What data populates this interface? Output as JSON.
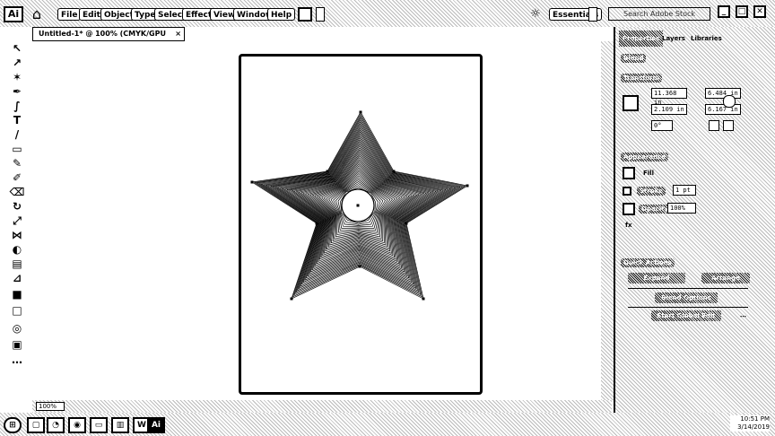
{
  "app": {
    "logo": "Ai"
  },
  "menubar": {
    "items": [
      "File",
      "Edit",
      "Object",
      "Type",
      "Select",
      "Effect",
      "View",
      "Window",
      "Help"
    ],
    "workspace": "Essentials",
    "search_placeholder": "Search Adobe Stock"
  },
  "document": {
    "tab_title": "Untitled-1* @ 100% (CMYK/GPU Preview)",
    "zoom": "100%"
  },
  "panel": {
    "tabs": [
      "Properties",
      "Layers",
      "Libraries"
    ],
    "selection_type": "Blend",
    "transform": {
      "title": "Transform",
      "x": "11.368 in",
      "y": "2.109 in",
      "w": "6.484 in",
      "h": "6.167 in",
      "angle": "0°"
    },
    "appearance": {
      "title": "Appearance",
      "fill_label": "Fill",
      "stroke_label": "Stroke",
      "stroke_value": "1 pt",
      "opacity_label": "Opacity",
      "opacity_value": "100%"
    },
    "quick_actions": {
      "title": "Quick Actions",
      "expand": "Expand",
      "arrange": "Arrange",
      "blend_options": "Blend Options",
      "start_global_edit": "Start Global Edit"
    }
  },
  "taskbar": {
    "time": "10:51 PM",
    "date": "3/14/2019"
  },
  "colors": {
    "accent": "#000000",
    "background": "#ffffff"
  }
}
